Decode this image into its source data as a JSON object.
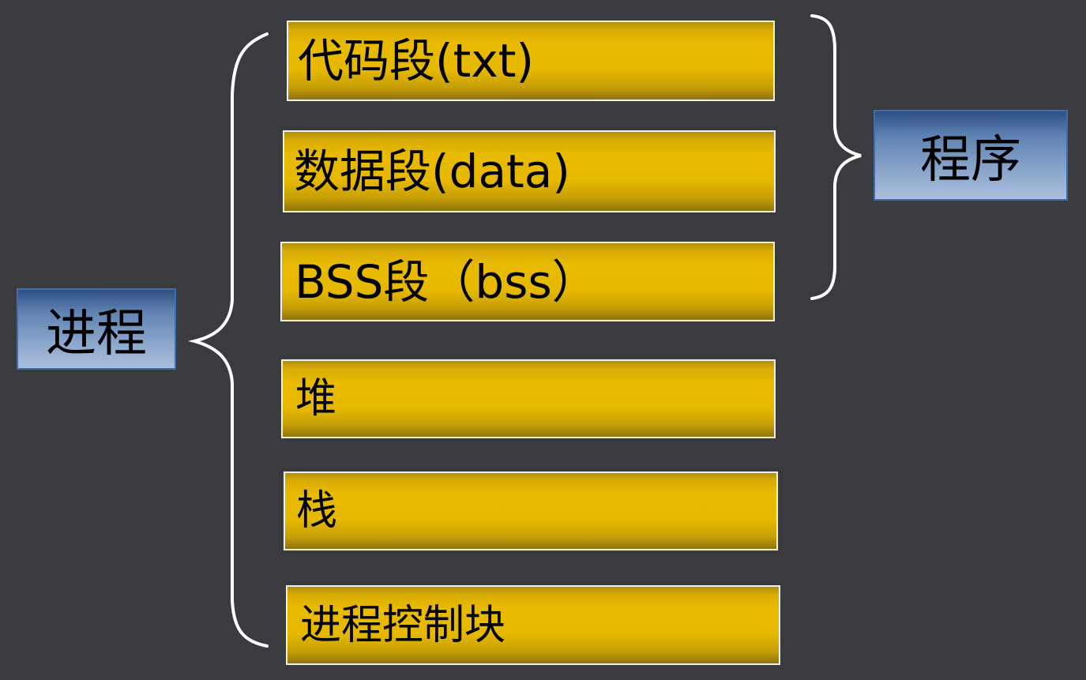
{
  "program_segments": [
    {
      "label": "代码段(txt)"
    },
    {
      "label": "数据段(data)"
    },
    {
      "label": "BSS段（bss）"
    }
  ],
  "runtime_segments": [
    {
      "label": "堆"
    },
    {
      "label": "栈"
    },
    {
      "label": "进程控制块"
    }
  ],
  "process_label": "进程",
  "program_label": "程序",
  "colors": {
    "background": "#3a3b3f",
    "segment_fill": "#e6b800",
    "label_fill": "#8da8cc",
    "brace": "#ffffff"
  }
}
